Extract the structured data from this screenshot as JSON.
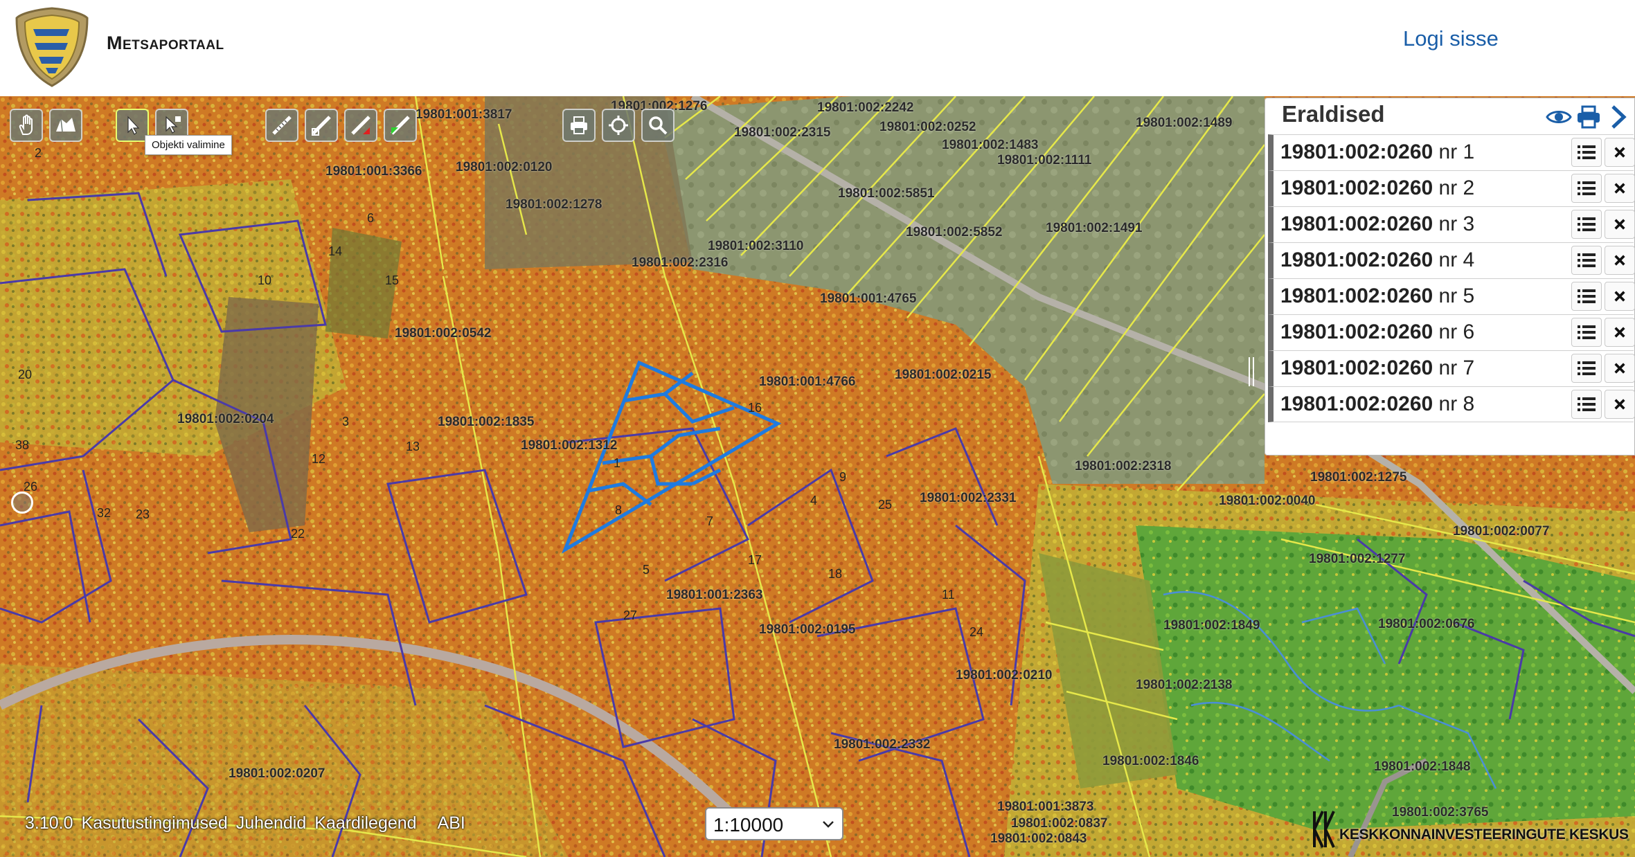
{
  "header": {
    "site_title": "Metsaportaal",
    "login_label": "Logi sisse"
  },
  "toolbar": {
    "tooltip": "Objekti valimine",
    "groups": [
      {
        "name": "navigation",
        "tools": [
          "hand-pan-icon",
          "map-layers-icon"
        ]
      },
      {
        "name": "selection",
        "tools": [
          "select-arrow-icon",
          "select-info-icon"
        ]
      },
      {
        "name": "drawing",
        "tools": [
          "measure-line-icon",
          "measure-area-icon",
          "draw-red-icon",
          "draw-green-icon"
        ]
      },
      {
        "name": "utilities",
        "tools": [
          "print-icon",
          "crosshair-icon",
          "search-icon"
        ]
      }
    ]
  },
  "panel": {
    "title": "Eraldised",
    "icons": [
      "eye-icon",
      "print-icon",
      "chevron-right-icon"
    ],
    "rows": [
      {
        "id": "19801:002:0260",
        "suffix": "nr 1"
      },
      {
        "id": "19801:002:0260",
        "suffix": "nr 2"
      },
      {
        "id": "19801:002:0260",
        "suffix": "nr 3"
      },
      {
        "id": "19801:002:0260",
        "suffix": "nr 4"
      },
      {
        "id": "19801:002:0260",
        "suffix": "nr 5"
      },
      {
        "id": "19801:002:0260",
        "suffix": "nr 6"
      },
      {
        "id": "19801:002:0260",
        "suffix": "nr 7"
      },
      {
        "id": "19801:002:0260",
        "suffix": "nr 8"
      }
    ]
  },
  "footer": {
    "version": "3.10.0",
    "links": [
      "Kasutustingimused",
      "Juhendid",
      "Kaardilegend"
    ],
    "abi": "ABI"
  },
  "scale": {
    "value": "1:10000"
  },
  "kik": {
    "text": "KESKKONNAINVESTEERINGUTE KESKUS"
  },
  "map": {
    "parcel_labels": [
      "19801:002:1276",
      "19801:002:2242",
      "19801:002:2315",
      "19801:002:0252",
      "19801:002:1483",
      "19801:002:1111",
      "19801:002:1489",
      "19801:002:0120",
      "19801:001:3366",
      "19801:002:5851",
      "19801:002:1278",
      "19801:002:5852",
      "19801:002:1491",
      "19801:002:3110",
      "19801:002:2316",
      "19801:001:4765",
      "19801:002:0542",
      "19801:001:4766",
      "19801:002:0215",
      "19801:002:0204",
      "19801:002:1835",
      "19801:002:1312",
      "19801:002:2318",
      "19801:002:1275",
      "19801:002:2331",
      "19801:002:0040",
      "19801:002:0077",
      "19801:002:1277",
      "19801:001:2363",
      "19801:002:0195",
      "19801:002:1849",
      "19801:002:0676",
      "19801:002:0210",
      "19801:002:2138",
      "19801:002:2332",
      "19801:002:1846",
      "19801:002:1848",
      "19801:002:0207",
      "19801:001:3873",
      "19801:002:0837",
      "19801:002:0843",
      "19801:002:3765",
      "19801:001:3817"
    ],
    "stand_numbers": [
      "2",
      "6",
      "10",
      "14",
      "15",
      "20",
      "38",
      "26",
      "32",
      "23",
      "22",
      "3",
      "12",
      "7",
      "4",
      "5",
      "16",
      "9",
      "1",
      "13",
      "17",
      "25",
      "27",
      "8",
      "11",
      "24",
      "18"
    ],
    "colors": {
      "forest_orange": "#d9822a",
      "forest_yellow": "#c8b436",
      "field_gray": "#8c9670",
      "green_area": "#5fa63a",
      "parcel_line": "#e6e84a",
      "stand_line": "#4a3aa8",
      "selected_outline": "#1e7be0",
      "road": "#b9a9a0"
    }
  }
}
